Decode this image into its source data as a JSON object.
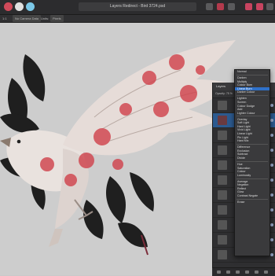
{
  "window": {
    "title": "Layers Redirect - Bird 3724.psd",
    "context_left": "1:1",
    "context_profile": "No Camera Data",
    "context_units_label": "Units:",
    "context_units": "Pixels"
  },
  "layers_panel": {
    "tab": "Layers",
    "opacity_label": "Opacity:",
    "opacity_value": "75 %"
  },
  "blend_menu": {
    "items": [
      "Normal",
      "---",
      "Darken",
      "Multiply",
      "Colour Burn",
      "Linear Burn",
      "Darker Colour",
      "---",
      "Lighten",
      "Screen",
      "Colour Dodge",
      "Add",
      "Lighter Colour",
      "---",
      "Overlay",
      "Soft Light",
      "Hard Light",
      "Vivid Light",
      "Linear Light",
      "Pin Light",
      "Hard Mix",
      "---",
      "Difference",
      "Exclusion",
      "Subtract",
      "Divide",
      "---",
      "Hue",
      "Saturation",
      "Colour",
      "Luminosity",
      "---",
      "Average",
      "Negation",
      "Reflect",
      "Glow",
      "Contrast Negate",
      "---",
      "Erase"
    ],
    "highlighted": "Linear Burn"
  },
  "colors": {
    "accent": "#2f71c9",
    "petal": "#d0404a"
  }
}
